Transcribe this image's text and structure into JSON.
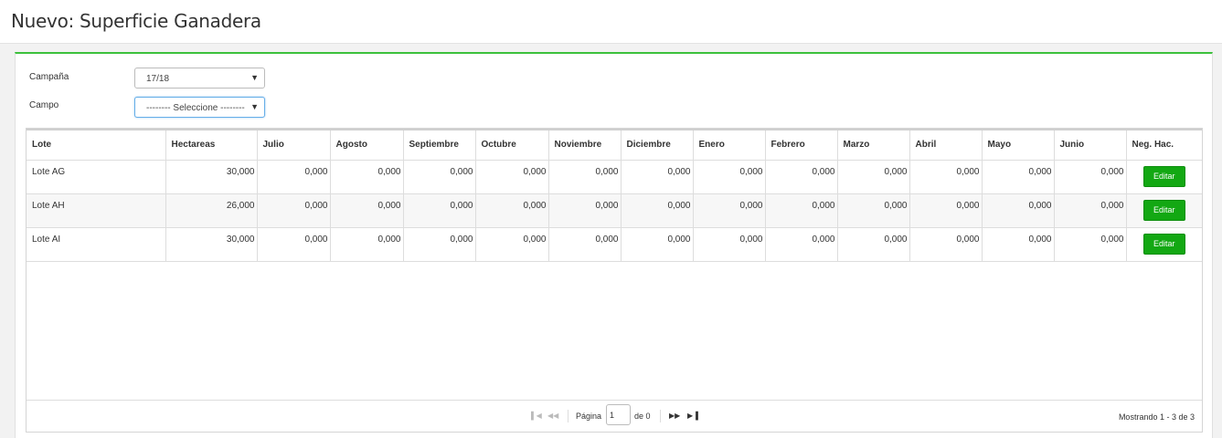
{
  "page": {
    "title": "Nuevo: Superficie Ganadera"
  },
  "form": {
    "campaign_label": "Campaña",
    "campaign_value": "17/18",
    "field_label": "Campo",
    "field_value": "-------- Seleccione --------"
  },
  "table": {
    "columns": [
      "Lote",
      "Hectareas",
      "Julio",
      "Agosto",
      "Septiembre",
      "Octubre",
      "Noviembre",
      "Diciembre",
      "Enero",
      "Febrero",
      "Marzo",
      "Abril",
      "Mayo",
      "Junio",
      "Neg. Hac."
    ],
    "rows": [
      {
        "lote": "Lote AG",
        "values": [
          "30,000",
          "0,000",
          "0,000",
          "0,000",
          "0,000",
          "0,000",
          "0,000",
          "0,000",
          "0,000",
          "0,000",
          "0,000",
          "0,000",
          "0,000"
        ],
        "action": "Editar"
      },
      {
        "lote": "Lote AH",
        "values": [
          "26,000",
          "0,000",
          "0,000",
          "0,000",
          "0,000",
          "0,000",
          "0,000",
          "0,000",
          "0,000",
          "0,000",
          "0,000",
          "0,000",
          "0,000"
        ],
        "action": "Editar"
      },
      {
        "lote": "Lote AI",
        "values": [
          "30,000",
          "0,000",
          "0,000",
          "0,000",
          "0,000",
          "0,000",
          "0,000",
          "0,000",
          "0,000",
          "0,000",
          "0,000",
          "0,000",
          "0,000"
        ],
        "action": "Editar"
      }
    ]
  },
  "pager": {
    "page_label": "Página",
    "page_value": "1",
    "of_label": "de 0",
    "info": "Mostrando 1 - 3 de 3"
  },
  "colors": {
    "accent": "#3cc13c",
    "button": "#13a813"
  }
}
